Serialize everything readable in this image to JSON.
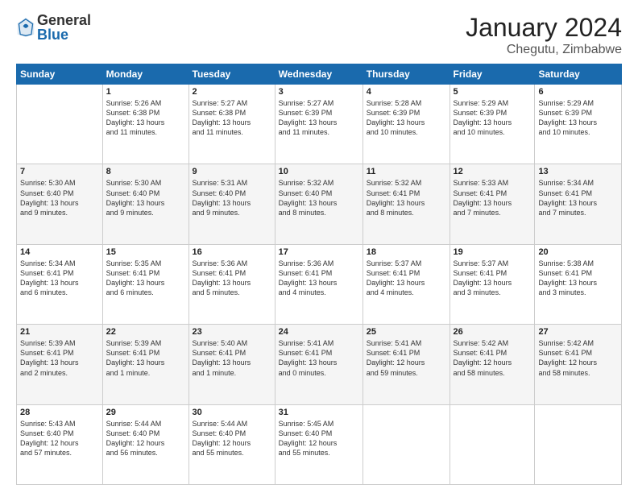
{
  "logo": {
    "general": "General",
    "blue": "Blue"
  },
  "title": "January 2024",
  "location": "Chegutu, Zimbabwe",
  "days_header": [
    "Sunday",
    "Monday",
    "Tuesday",
    "Wednesday",
    "Thursday",
    "Friday",
    "Saturday"
  ],
  "weeks": [
    [
      {
        "num": "",
        "info": ""
      },
      {
        "num": "1",
        "info": "Sunrise: 5:26 AM\nSunset: 6:38 PM\nDaylight: 13 hours\nand 11 minutes."
      },
      {
        "num": "2",
        "info": "Sunrise: 5:27 AM\nSunset: 6:38 PM\nDaylight: 13 hours\nand 11 minutes."
      },
      {
        "num": "3",
        "info": "Sunrise: 5:27 AM\nSunset: 6:39 PM\nDaylight: 13 hours\nand 11 minutes."
      },
      {
        "num": "4",
        "info": "Sunrise: 5:28 AM\nSunset: 6:39 PM\nDaylight: 13 hours\nand 10 minutes."
      },
      {
        "num": "5",
        "info": "Sunrise: 5:29 AM\nSunset: 6:39 PM\nDaylight: 13 hours\nand 10 minutes."
      },
      {
        "num": "6",
        "info": "Sunrise: 5:29 AM\nSunset: 6:39 PM\nDaylight: 13 hours\nand 10 minutes."
      }
    ],
    [
      {
        "num": "7",
        "info": "Sunrise: 5:30 AM\nSunset: 6:40 PM\nDaylight: 13 hours\nand 9 minutes."
      },
      {
        "num": "8",
        "info": "Sunrise: 5:30 AM\nSunset: 6:40 PM\nDaylight: 13 hours\nand 9 minutes."
      },
      {
        "num": "9",
        "info": "Sunrise: 5:31 AM\nSunset: 6:40 PM\nDaylight: 13 hours\nand 9 minutes."
      },
      {
        "num": "10",
        "info": "Sunrise: 5:32 AM\nSunset: 6:40 PM\nDaylight: 13 hours\nand 8 minutes."
      },
      {
        "num": "11",
        "info": "Sunrise: 5:32 AM\nSunset: 6:41 PM\nDaylight: 13 hours\nand 8 minutes."
      },
      {
        "num": "12",
        "info": "Sunrise: 5:33 AM\nSunset: 6:41 PM\nDaylight: 13 hours\nand 7 minutes."
      },
      {
        "num": "13",
        "info": "Sunrise: 5:34 AM\nSunset: 6:41 PM\nDaylight: 13 hours\nand 7 minutes."
      }
    ],
    [
      {
        "num": "14",
        "info": "Sunrise: 5:34 AM\nSunset: 6:41 PM\nDaylight: 13 hours\nand 6 minutes."
      },
      {
        "num": "15",
        "info": "Sunrise: 5:35 AM\nSunset: 6:41 PM\nDaylight: 13 hours\nand 6 minutes."
      },
      {
        "num": "16",
        "info": "Sunrise: 5:36 AM\nSunset: 6:41 PM\nDaylight: 13 hours\nand 5 minutes."
      },
      {
        "num": "17",
        "info": "Sunrise: 5:36 AM\nSunset: 6:41 PM\nDaylight: 13 hours\nand 4 minutes."
      },
      {
        "num": "18",
        "info": "Sunrise: 5:37 AM\nSunset: 6:41 PM\nDaylight: 13 hours\nand 4 minutes."
      },
      {
        "num": "19",
        "info": "Sunrise: 5:37 AM\nSunset: 6:41 PM\nDaylight: 13 hours\nand 3 minutes."
      },
      {
        "num": "20",
        "info": "Sunrise: 5:38 AM\nSunset: 6:41 PM\nDaylight: 13 hours\nand 3 minutes."
      }
    ],
    [
      {
        "num": "21",
        "info": "Sunrise: 5:39 AM\nSunset: 6:41 PM\nDaylight: 13 hours\nand 2 minutes."
      },
      {
        "num": "22",
        "info": "Sunrise: 5:39 AM\nSunset: 6:41 PM\nDaylight: 13 hours\nand 1 minute."
      },
      {
        "num": "23",
        "info": "Sunrise: 5:40 AM\nSunset: 6:41 PM\nDaylight: 13 hours\nand 1 minute."
      },
      {
        "num": "24",
        "info": "Sunrise: 5:41 AM\nSunset: 6:41 PM\nDaylight: 13 hours\nand 0 minutes."
      },
      {
        "num": "25",
        "info": "Sunrise: 5:41 AM\nSunset: 6:41 PM\nDaylight: 12 hours\nand 59 minutes."
      },
      {
        "num": "26",
        "info": "Sunrise: 5:42 AM\nSunset: 6:41 PM\nDaylight: 12 hours\nand 58 minutes."
      },
      {
        "num": "27",
        "info": "Sunrise: 5:42 AM\nSunset: 6:41 PM\nDaylight: 12 hours\nand 58 minutes."
      }
    ],
    [
      {
        "num": "28",
        "info": "Sunrise: 5:43 AM\nSunset: 6:40 PM\nDaylight: 12 hours\nand 57 minutes."
      },
      {
        "num": "29",
        "info": "Sunrise: 5:44 AM\nSunset: 6:40 PM\nDaylight: 12 hours\nand 56 minutes."
      },
      {
        "num": "30",
        "info": "Sunrise: 5:44 AM\nSunset: 6:40 PM\nDaylight: 12 hours\nand 55 minutes."
      },
      {
        "num": "31",
        "info": "Sunrise: 5:45 AM\nSunset: 6:40 PM\nDaylight: 12 hours\nand 55 minutes."
      },
      {
        "num": "",
        "info": ""
      },
      {
        "num": "",
        "info": ""
      },
      {
        "num": "",
        "info": ""
      }
    ]
  ]
}
